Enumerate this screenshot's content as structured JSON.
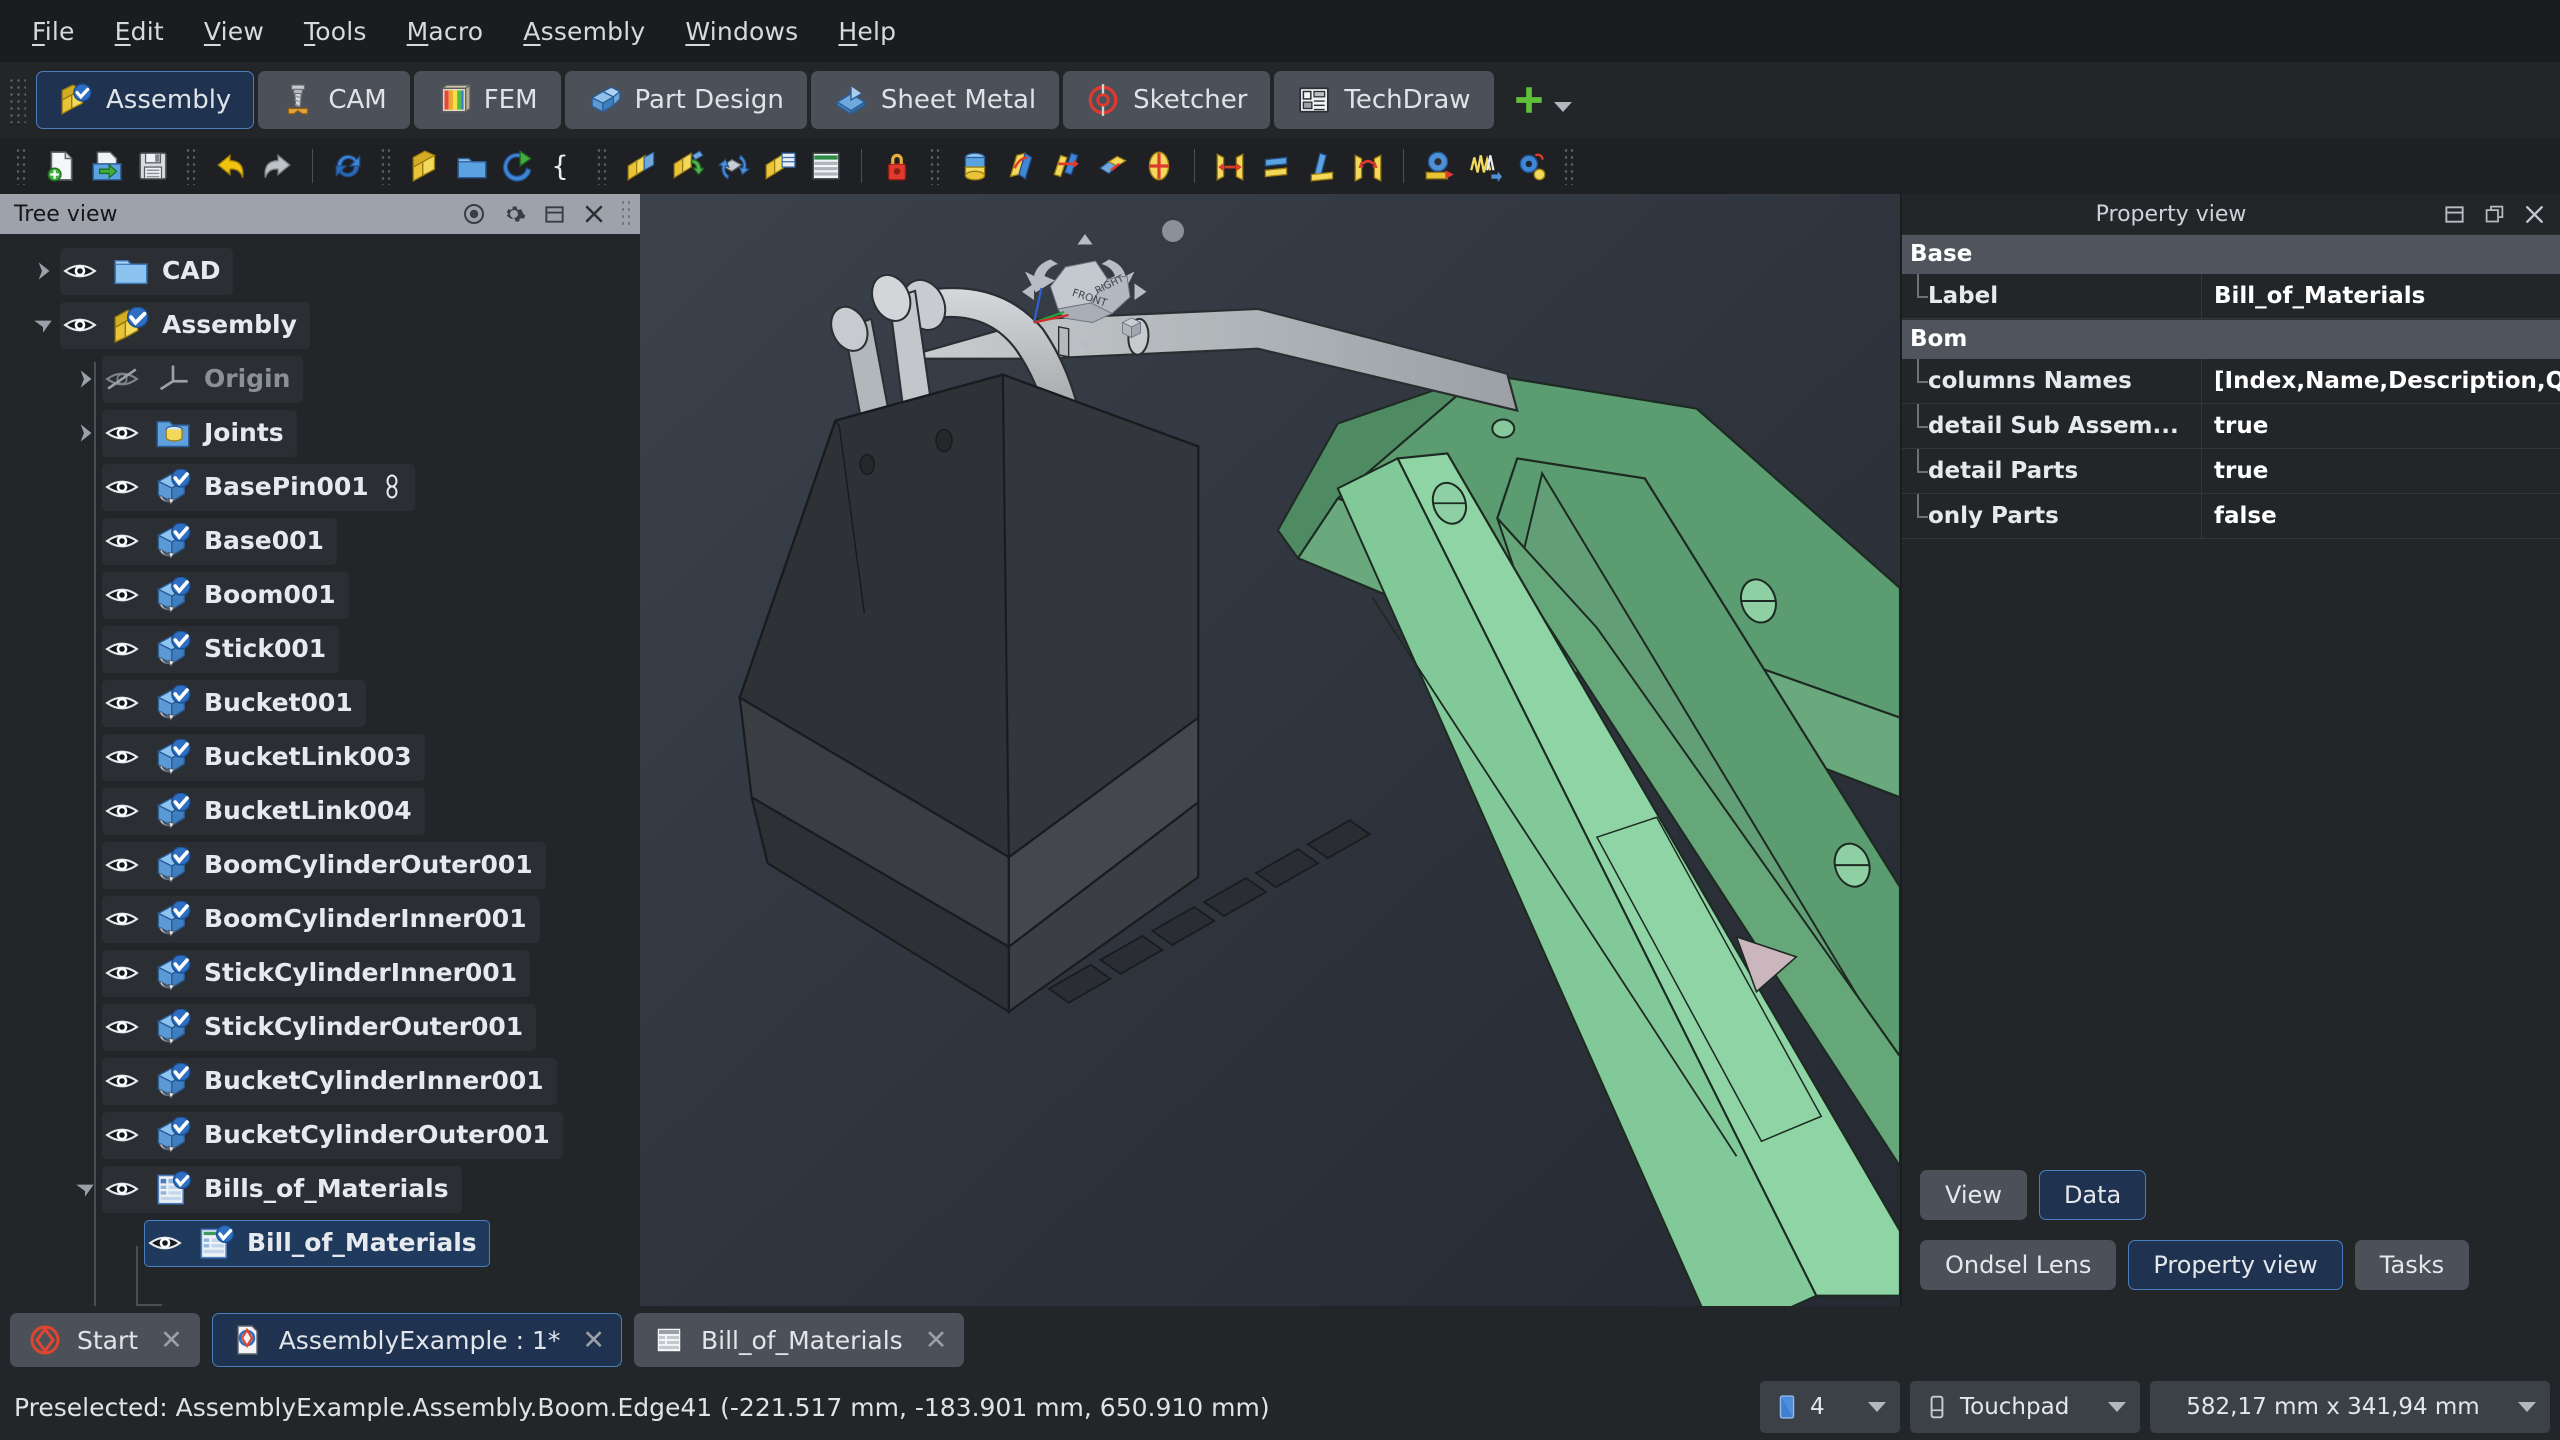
{
  "menu": {
    "items": [
      {
        "label": "File",
        "mnemonic": "F"
      },
      {
        "label": "Edit",
        "mnemonic": "E"
      },
      {
        "label": "View",
        "mnemonic": "V"
      },
      {
        "label": "Tools",
        "mnemonic": "T"
      },
      {
        "label": "Macro",
        "mnemonic": "M"
      },
      {
        "label": "Assembly",
        "mnemonic": "A"
      },
      {
        "label": "Windows",
        "mnemonic": "W"
      },
      {
        "label": "Help",
        "mnemonic": "H"
      }
    ]
  },
  "workbenches": {
    "items": [
      {
        "label": "Assembly",
        "icon": "assembly-icon",
        "active": true
      },
      {
        "label": "CAM",
        "icon": "cam-icon",
        "active": false
      },
      {
        "label": "FEM",
        "icon": "fem-icon",
        "active": false
      },
      {
        "label": "Part Design",
        "icon": "part-design-icon",
        "active": false
      },
      {
        "label": "Sheet Metal",
        "icon": "sheet-metal-icon",
        "active": false
      },
      {
        "label": "Sketcher",
        "icon": "sketcher-icon",
        "active": false
      },
      {
        "label": "TechDraw",
        "icon": "techdraw-icon",
        "active": false
      }
    ],
    "add_label": "+"
  },
  "toolbar": {
    "icons": [
      "new-document-icon",
      "open-document-icon",
      "save-document-icon",
      "undo-icon",
      "redo-icon",
      "refresh-icon",
      "create-assembly-icon",
      "create-part-icon",
      "insert-link-icon",
      "create-variable-set-icon",
      "solve-assembly-icon",
      "insert-component-icon",
      "toggle-exploded-view-icon",
      "create-bom-icon",
      "export-bom-icon",
      "joint-lock-icon",
      "cylindrical-joint-icon",
      "revolute-joint-icon",
      "slider-joint-icon",
      "ball-joint-icon",
      "fixed-joint-icon",
      "distance-joint-icon",
      "parallel-joint-icon",
      "perpendicular-joint-icon",
      "angle-joint-icon",
      "measure-icon",
      "simulation-icon",
      "settings-joint-icon"
    ]
  },
  "tree_panel": {
    "title": "Tree view",
    "header_icons": [
      "visibility-icon",
      "gear-icon",
      "undock-icon",
      "close-icon"
    ],
    "items": [
      {
        "label": "CAD",
        "depth": 0,
        "arrow": "right",
        "eye": "visible",
        "icon": "folder-icon",
        "selected": false,
        "dim": false
      },
      {
        "label": "Assembly",
        "depth": 0,
        "arrow": "down",
        "eye": "visible",
        "icon": "assembly-check-icon",
        "selected": false,
        "dim": false
      },
      {
        "label": "Origin",
        "depth": 1,
        "arrow": "right",
        "eye": "hidden",
        "icon": "origin-icon",
        "selected": false,
        "dim": true
      },
      {
        "label": "Joints",
        "depth": 1,
        "arrow": "right",
        "eye": "visible",
        "icon": "joints-folder-icon",
        "selected": false,
        "dim": false
      },
      {
        "label": "BasePin001",
        "depth": 1,
        "arrow": "none",
        "eye": "visible",
        "icon": "part-link-icon",
        "selected": false,
        "dim": false,
        "badge": "link-badge-icon"
      },
      {
        "label": "Base001",
        "depth": 1,
        "arrow": "none",
        "eye": "visible",
        "icon": "part-link-icon",
        "selected": false,
        "dim": false
      },
      {
        "label": "Boom001",
        "depth": 1,
        "arrow": "none",
        "eye": "visible",
        "icon": "part-link-icon",
        "selected": false,
        "dim": false
      },
      {
        "label": "Stick001",
        "depth": 1,
        "arrow": "none",
        "eye": "visible",
        "icon": "part-link-icon",
        "selected": false,
        "dim": false
      },
      {
        "label": "Bucket001",
        "depth": 1,
        "arrow": "none",
        "eye": "visible",
        "icon": "part-link-icon",
        "selected": false,
        "dim": false
      },
      {
        "label": "BucketLink003",
        "depth": 1,
        "arrow": "none",
        "eye": "visible",
        "icon": "part-link-icon",
        "selected": false,
        "dim": false
      },
      {
        "label": "BucketLink004",
        "depth": 1,
        "arrow": "none",
        "eye": "visible",
        "icon": "part-link-icon",
        "selected": false,
        "dim": false
      },
      {
        "label": "BoomCylinderOuter001",
        "depth": 1,
        "arrow": "none",
        "eye": "visible",
        "icon": "part-link-icon",
        "selected": false,
        "dim": false
      },
      {
        "label": "BoomCylinderInner001",
        "depth": 1,
        "arrow": "none",
        "eye": "visible",
        "icon": "part-link-icon",
        "selected": false,
        "dim": false
      },
      {
        "label": "StickCylinderInner001",
        "depth": 1,
        "arrow": "none",
        "eye": "visible",
        "icon": "part-link-icon",
        "selected": false,
        "dim": false
      },
      {
        "label": "StickCylinderOuter001",
        "depth": 1,
        "arrow": "none",
        "eye": "visible",
        "icon": "part-link-icon",
        "selected": false,
        "dim": false
      },
      {
        "label": "BucketCylinderInner001",
        "depth": 1,
        "arrow": "none",
        "eye": "visible",
        "icon": "part-link-icon",
        "selected": false,
        "dim": false
      },
      {
        "label": "BucketCylinderOuter001",
        "depth": 1,
        "arrow": "none",
        "eye": "visible",
        "icon": "part-link-icon",
        "selected": false,
        "dim": false
      },
      {
        "label": "Bills_of_Materials",
        "depth": 1,
        "arrow": "down",
        "eye": "visible",
        "icon": "bom-folder-icon",
        "selected": false,
        "dim": false
      },
      {
        "label": "Bill_of_Materials",
        "depth": 2,
        "arrow": "none",
        "eye": "visible",
        "icon": "bom-icon",
        "selected": true,
        "dim": false
      }
    ]
  },
  "property_panel": {
    "title": "Property view",
    "header_icons": [
      "dock-icon",
      "float-icon",
      "close-icon"
    ],
    "groups": [
      {
        "name": "Base",
        "rows": [
          {
            "key": "Label",
            "value": "Bill_of_Materials"
          }
        ]
      },
      {
        "name": "Bom",
        "rows": [
          {
            "key": "columns Names",
            "value": "[Index,Name,Description,Q..."
          },
          {
            "key": "detail Sub Assem...",
            "value": "true"
          },
          {
            "key": "detail Parts",
            "value": "true"
          },
          {
            "key": "only Parts",
            "value": "false"
          }
        ]
      }
    ],
    "view_data_buttons": [
      {
        "label": "View",
        "active": false
      },
      {
        "label": "Data",
        "active": true
      }
    ],
    "panel_buttons": [
      {
        "label": "Ondsel Lens",
        "active": false
      },
      {
        "label": "Property view",
        "active": true
      },
      {
        "label": "Tasks",
        "active": false
      }
    ]
  },
  "document_tabs": {
    "items": [
      {
        "label": "Start",
        "icon": "start-page-icon",
        "active": false,
        "close": "✕"
      },
      {
        "label": "AssemblyExample : 1*",
        "icon": "freecad-doc-icon",
        "active": true,
        "close": "✕"
      },
      {
        "label": "Bill_of_Materials",
        "icon": "spreadsheet-icon",
        "active": false,
        "close": "✕"
      }
    ]
  },
  "status_bar": {
    "message": "Preselected: AssemblyExample.Assembly.Boom.Edge41 (-221.517 mm, -183.901 mm, 650.910 mm)",
    "scene_count": "4",
    "navigation_style": "Touchpad",
    "dimensions": "582,17 mm x 341,94 mm"
  },
  "navigation_cube": {
    "face_front": "FRONT",
    "face_right": "RIGHT"
  },
  "colors": {
    "accent": "#4a7fbf",
    "accent_bg": "#1f3350",
    "panel_bg": "#232629",
    "toolbar_bg": "#1e2023",
    "menubar_bg": "#1a1c1e",
    "model_green": "#5e9e73",
    "model_green_light": "#8fd3a4",
    "model_dark": "#2f3337",
    "model_grey": "#b3b7bb"
  }
}
